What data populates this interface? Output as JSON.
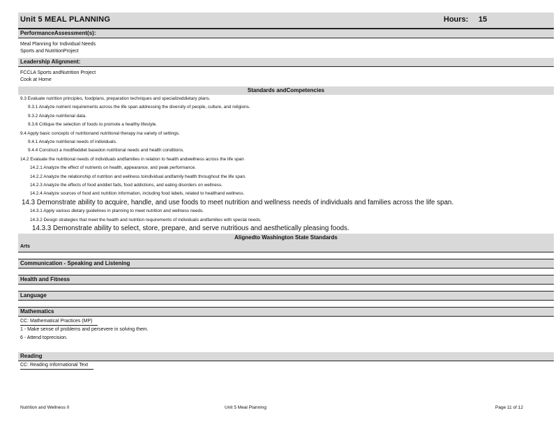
{
  "header": {
    "unit_title": "Unit   5     MEAL     PLANNING",
    "hours_label": "Hours:",
    "hours_value": "15"
  },
  "performance": {
    "heading": "PerformanceAssessment(s):",
    "lines": [
      "Meal   Planning   for  Individual   Needs",
      "Sports   and   NutritionProject"
    ]
  },
  "leadership": {
    "heading": "Leadership        Alignment:",
    "lines": [
      "FCCLA   Sports   andNutrition   Project",
      "Cook   at   Home"
    ]
  },
  "standards": {
    "heading": "Standards        andCompetencies",
    "items": [
      {
        "level": "l1",
        "size": "std",
        "text": "9.3  Evaluate     nutrition    principles,       foodplans,        preparation        techniques        and    specializeddietary          plans."
      },
      {
        "level": "l2",
        "size": "std",
        "text": "9.3.1    Analyze     nutrient     requirements        across    the   life  span   addressing       the   diversity    of  people,     culture,      and    religions."
      },
      {
        "level": "l2",
        "size": "std",
        "text": "9.3.2    Analyze     nutritional      data."
      },
      {
        "level": "l2",
        "size": "std",
        "text": "9.3.6    Critique     the   selection      of  foods    to  promote      a  healthy     lifestyle."
      },
      {
        "level": "l1",
        "size": "std",
        "text": "9.4  Apply    basic    concepts     of  nutritionand        nutritional        therapy     ina  variety    of  settings."
      },
      {
        "level": "l2",
        "size": "std",
        "text": "9.4.1    Analyze     nutritional      needs    of  individuals."
      },
      {
        "level": "l2",
        "size": "std",
        "text": "9.4.4    Construct      a  modifieddiet       basedon      nutritional       needs    and   health    conditions."
      },
      {
        "level": "l1",
        "size": "std",
        "text": "14.2    Evaluate      the   nutritional       needs     of  individuals      andfamilies       in  relation     to  health    andwellness        across     the   life  span"
      },
      {
        "level": "l3",
        "size": "std",
        "text": "14.2.1    Analyze     the   effect    of  nutrients      on  health,     appearance,        and   peak   performance."
      },
      {
        "level": "l3",
        "size": "std",
        "text": "14.2.2    Analyze     the   relationship      of   nutrition      and    wellness     toindividual        andfamily      health     throughout        the   life  span."
      },
      {
        "level": "l3",
        "size": "std",
        "text": "14.2.3    Analyze     the   effects    of  food   anddiet     fads,    food   addictions,       and   eating    disorders      on   wellness."
      },
      {
        "level": "l3",
        "size": "std",
        "text": "14.2.4    Analyze     sources     of  food   and   nutrition     information,         including       food   labels,     related     to  healthand        wellness."
      },
      {
        "level": "l1",
        "size": "big",
        "text": "14.3  Demonstrate ability to acquire, handle, and use foods to meet nutrition and wellness needs of individuals and families across the life span."
      },
      {
        "level": "l3",
        "size": "std",
        "text": "14.3.1    Apply    various    dietary    guidelines       in  planning       to  meet    nutrition      and    wellness      needs."
      },
      {
        "level": "l3",
        "size": "std",
        "text": "14.3.2    Design     strategies      that   meet    the   health    and    nutrition     requirements           of  individuals        andfamilies        with   special     needs."
      },
      {
        "level": "l2",
        "size": "big",
        "text": "14.3.3   Demonstrate ability to select, store, prepare, and serve nutritious and aesthetically pleasing foods."
      }
    ]
  },
  "aligned": {
    "heading": "Alignedto          Washington State                Standards",
    "first": "Arts"
  },
  "sections": [
    {
      "heading": "Communication          - Speaking       and    Listening",
      "lines": []
    },
    {
      "heading": "Health      and    Fitness",
      "lines": []
    },
    {
      "heading": "Language",
      "lines": []
    },
    {
      "heading": "Mathematics",
      "sub": "CC:   Mathematical       Practices      (MP)",
      "lines": [
        "1  - Make     sense    of  problems       and   persevere       in   solving      them.",
        "6  - Attend     toprecision."
      ]
    },
    {
      "heading": "Reading",
      "sub": "CC:   Reading     Informational        Text",
      "lines": []
    }
  ],
  "footer": {
    "left": "Nutrition     and   Wellness     II",
    "center": "Unit    5      Meal    Planning",
    "right": "Page     11   of  12"
  }
}
